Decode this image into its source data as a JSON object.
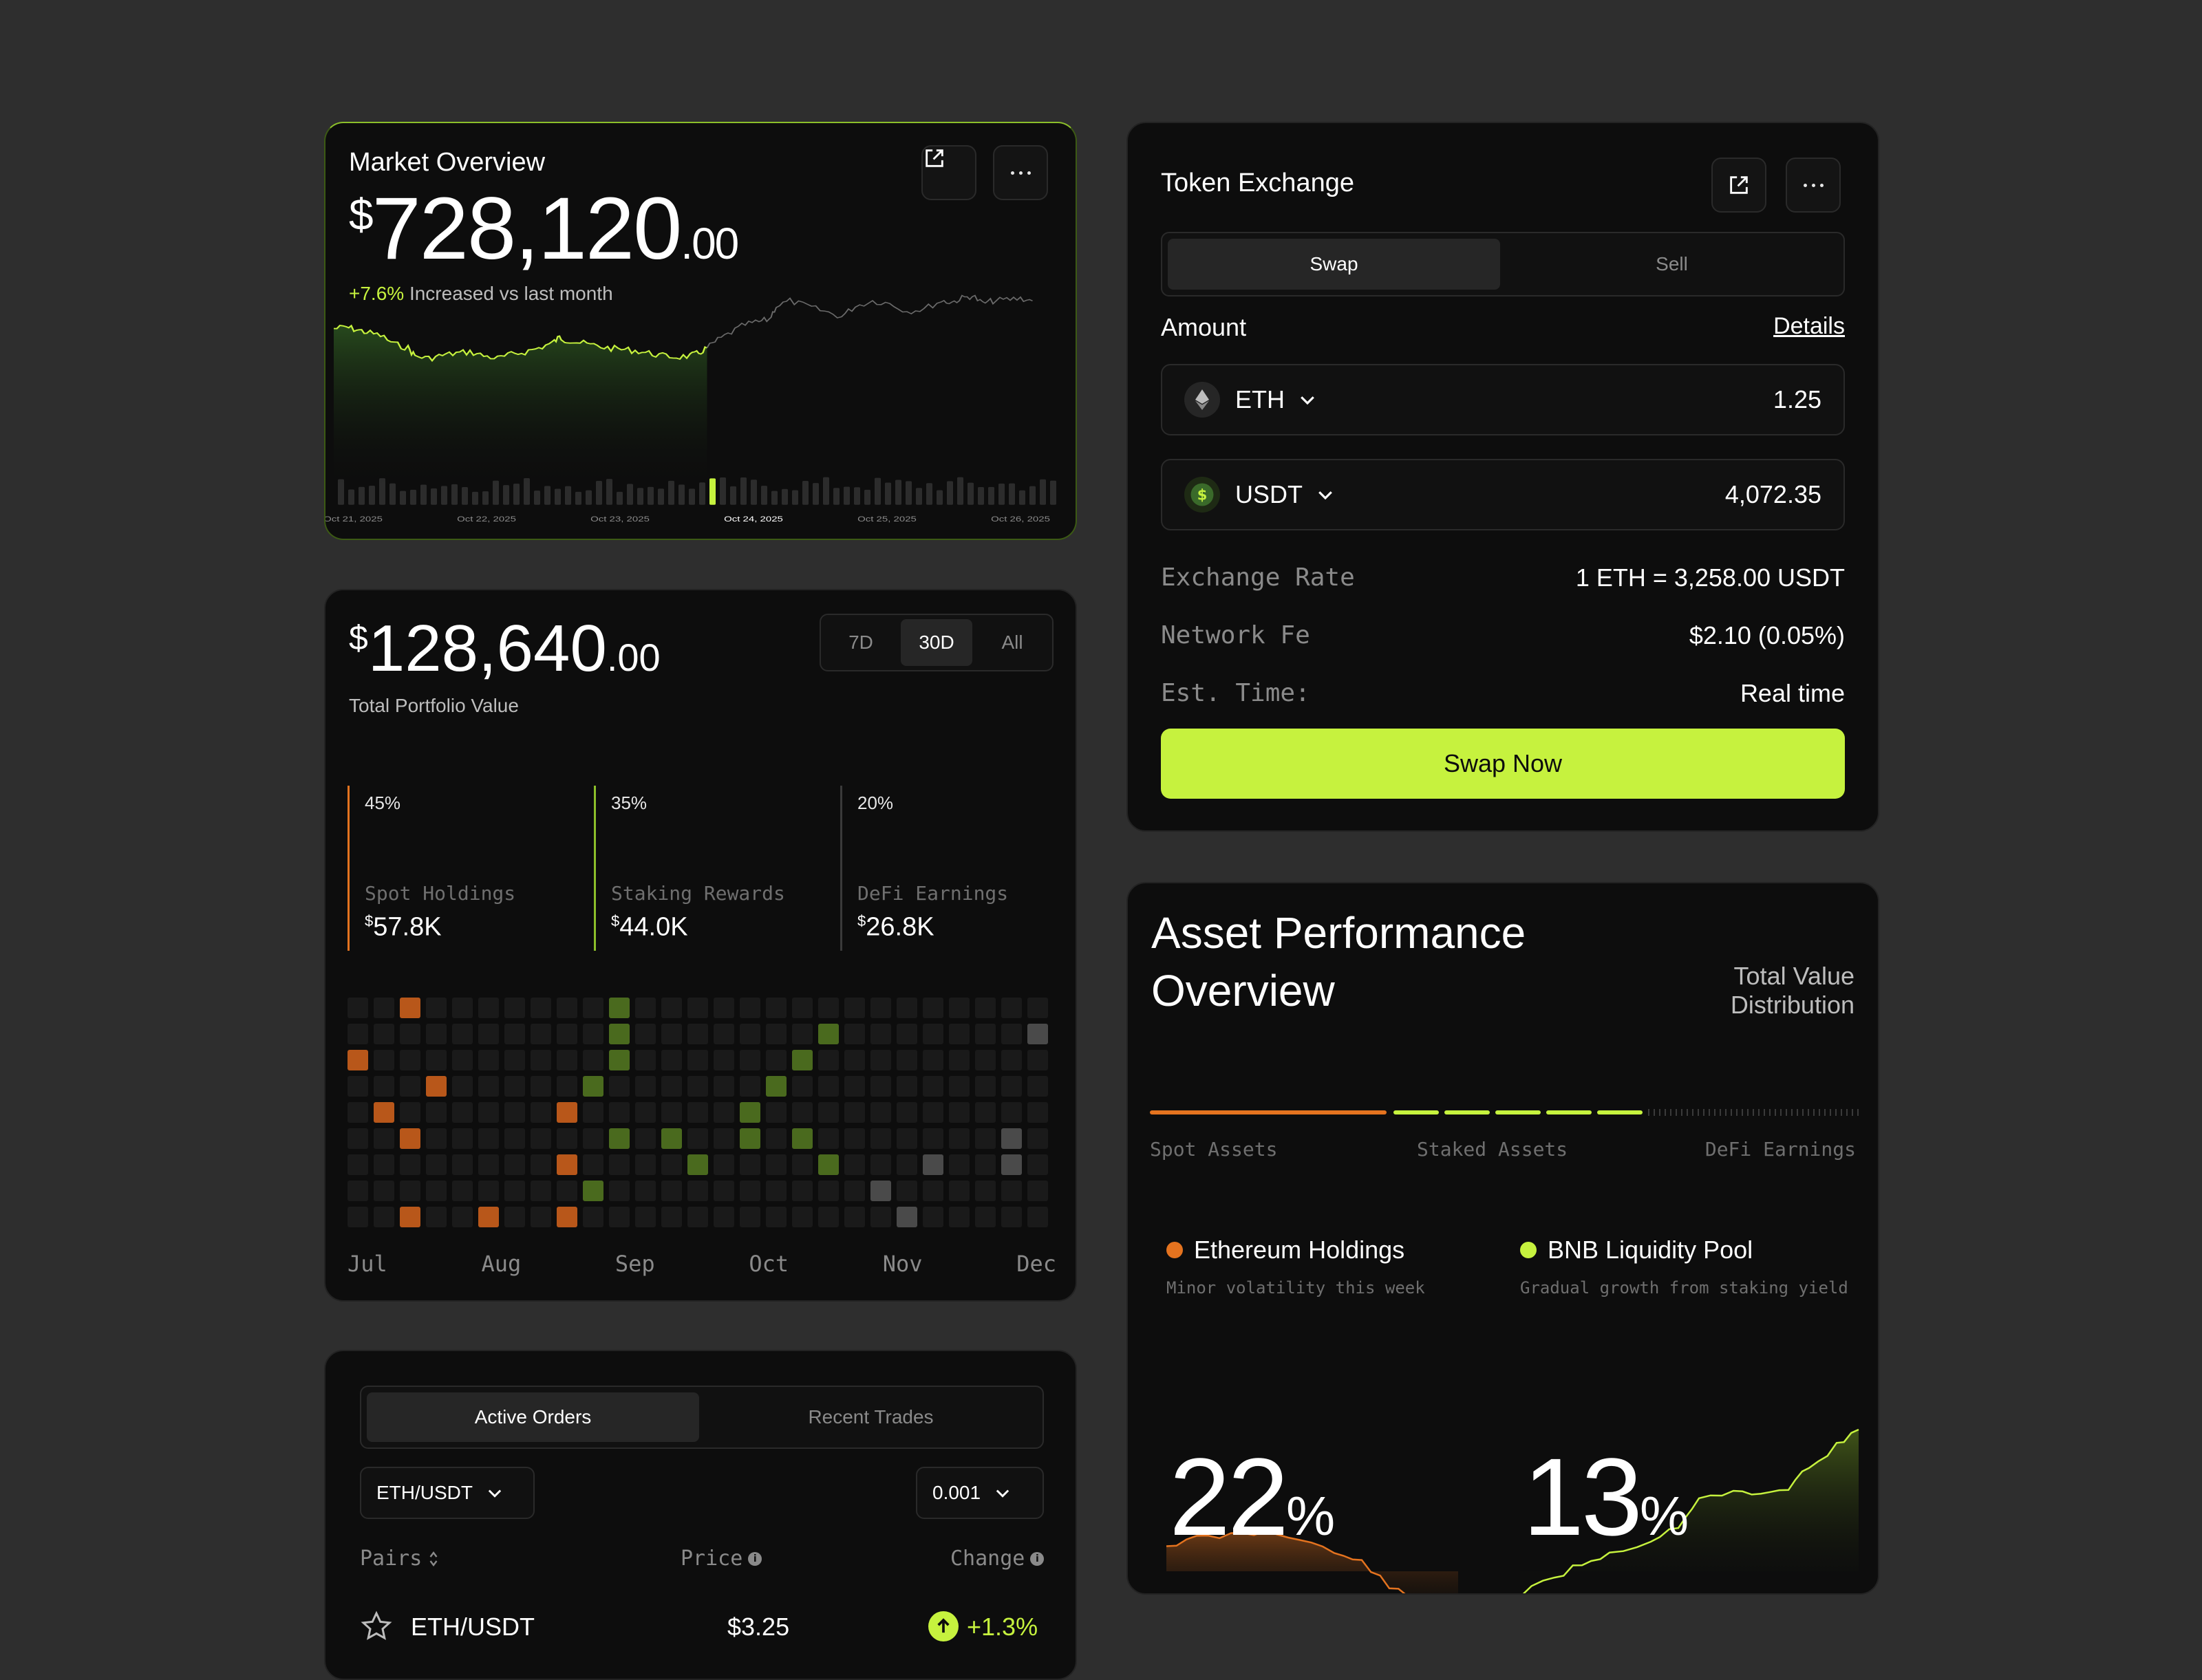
{
  "colors": {
    "accent": "#c6f23e",
    "orange": "#e4731f",
    "bg": "#2e2e2e",
    "card": "#0d0d0d"
  },
  "market": {
    "title": "Market Overview",
    "price_main": "728,120",
    "price_currency": "$",
    "price_cents": ".00",
    "change_pct": "+7.6%",
    "change_text": "Increased vs last month",
    "dates": [
      "Oct 21, 2025",
      "Oct 22, 2025",
      "Oct 23, 2025",
      "Oct 24, 2025",
      "Oct 25, 2025",
      "Oct 26, 2025"
    ],
    "icons": {
      "external": "external-link-icon",
      "more": "more-icon"
    }
  },
  "portfolio": {
    "currency": "$",
    "value_main": "128,640",
    "value_cents": ".00",
    "subtitle": "Total Portfolio Value",
    "ranges": [
      "7D",
      "30D",
      "All"
    ],
    "active_range": "30D",
    "stats": [
      {
        "pct": "45%",
        "label": "Spot Holdings",
        "value": "57.8K",
        "color": "#e4731f"
      },
      {
        "pct": "35%",
        "label": "Staking Rewards",
        "value": "44.0K",
        "color": "#c6f23e"
      },
      {
        "pct": "20%",
        "label": "DeFi Earnings",
        "value": "26.8K",
        "color": "#5a5a5a"
      }
    ],
    "months": [
      "Jul",
      "Aug",
      "Sep",
      "Oct",
      "Nov",
      "Dec"
    ]
  },
  "orders": {
    "tabs": [
      "Active Orders",
      "Recent Trades"
    ],
    "pair_select": "ETH/USDT",
    "step_select": "0.001",
    "columns": [
      "Pairs",
      "Price",
      "Change"
    ],
    "rows": [
      {
        "pair": "ETH/USDT",
        "price": "$3.25",
        "change": "+1.3%"
      }
    ]
  },
  "exchange": {
    "title": "Token Exchange",
    "tabs": [
      "Swap",
      "Sell"
    ],
    "amount_label": "Amount",
    "details_link": "Details",
    "from": {
      "token": "ETH",
      "amount": "1.25",
      "icon": "ethereum-icon"
    },
    "to": {
      "token": "USDT",
      "amount": "4,072.35",
      "icon": "dollar-icon"
    },
    "rate_label": "Exchange Rate",
    "rate_value": "1 ETH = 3,258.00 USDT",
    "fee_label": "Network Fe",
    "fee_value": "$2.10 (0.05%)",
    "time_label": "Est. Time:",
    "time_value": "Real time",
    "button": "Swap Now"
  },
  "asset": {
    "title_line1": "Asset Performance",
    "title_line2": "Overview",
    "tvd_line1": "Total Value",
    "tvd_line2": "Distribution",
    "dist_labels": [
      "Spot Assets",
      "Staked Assets",
      "DeFi Earnings"
    ],
    "items": [
      {
        "name": "Ethereum Holdings",
        "sub": "Minor volatility this week",
        "pct": "22",
        "color": "#e4731f"
      },
      {
        "name": "BNB Liquidity Pool",
        "sub": "Gradual growth from staking yield",
        "pct": "13",
        "color": "#c6f23e"
      }
    ],
    "pct_sign": "%"
  }
}
